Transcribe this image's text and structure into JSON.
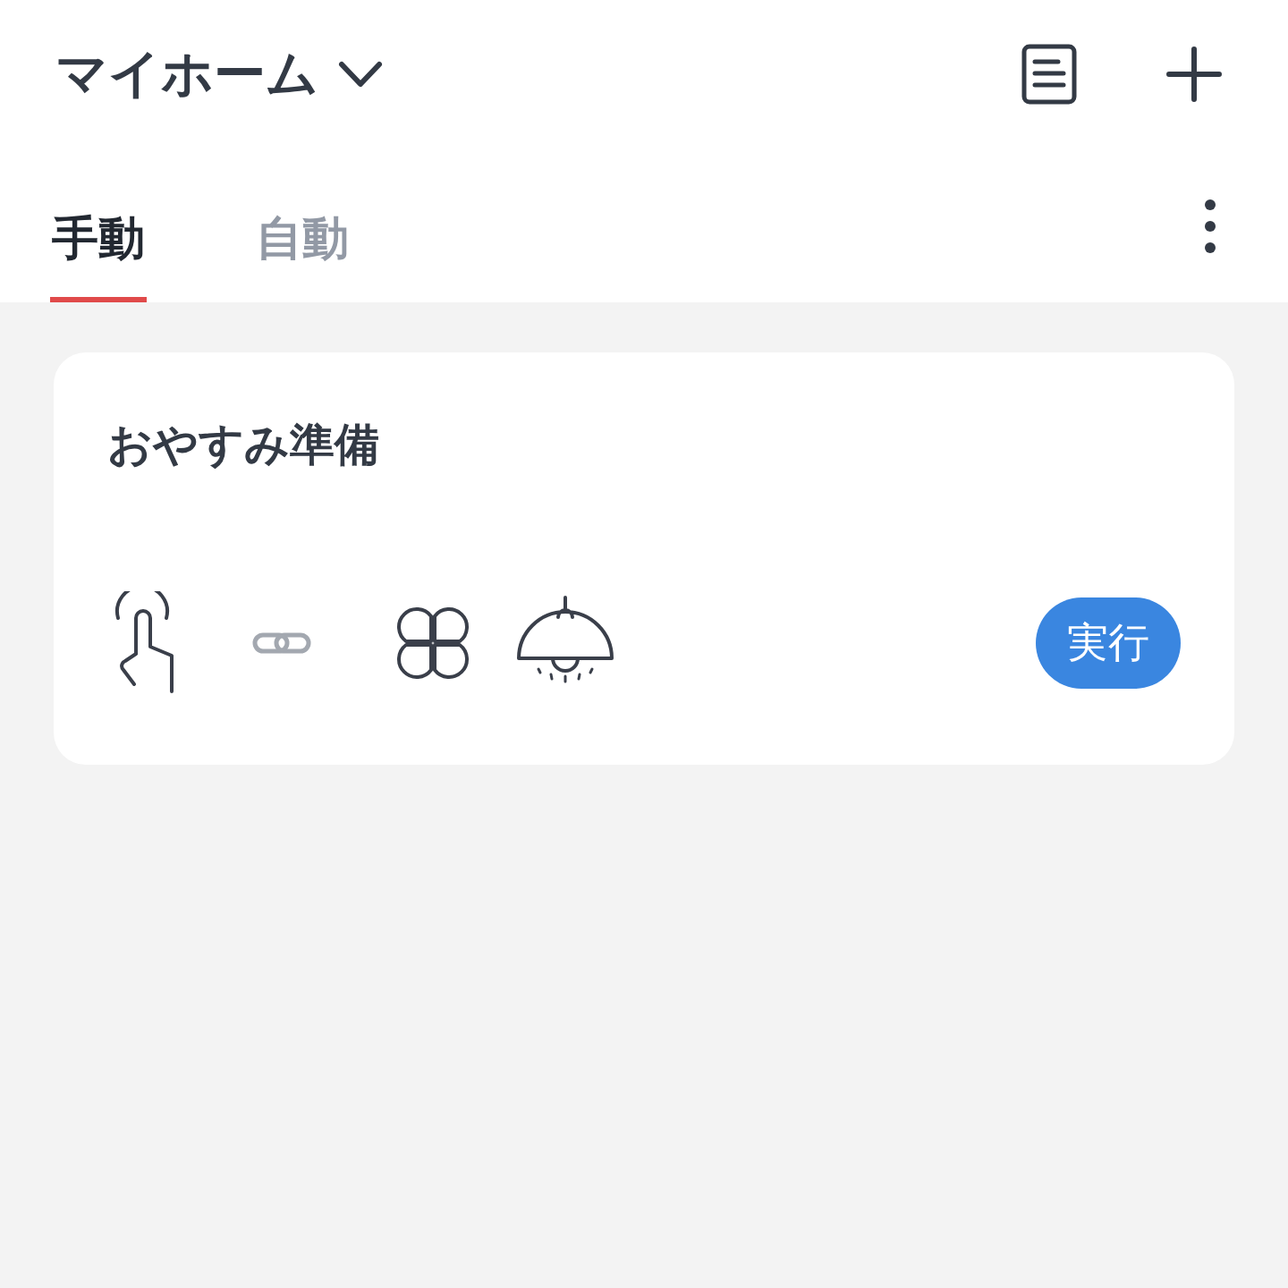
{
  "header": {
    "title": "マイホーム"
  },
  "tabs": [
    {
      "label": "手動",
      "selected": true
    },
    {
      "label": "自動",
      "selected": false
    }
  ],
  "scenes": [
    {
      "name": "おやすみ準備",
      "button": "実行"
    }
  ]
}
